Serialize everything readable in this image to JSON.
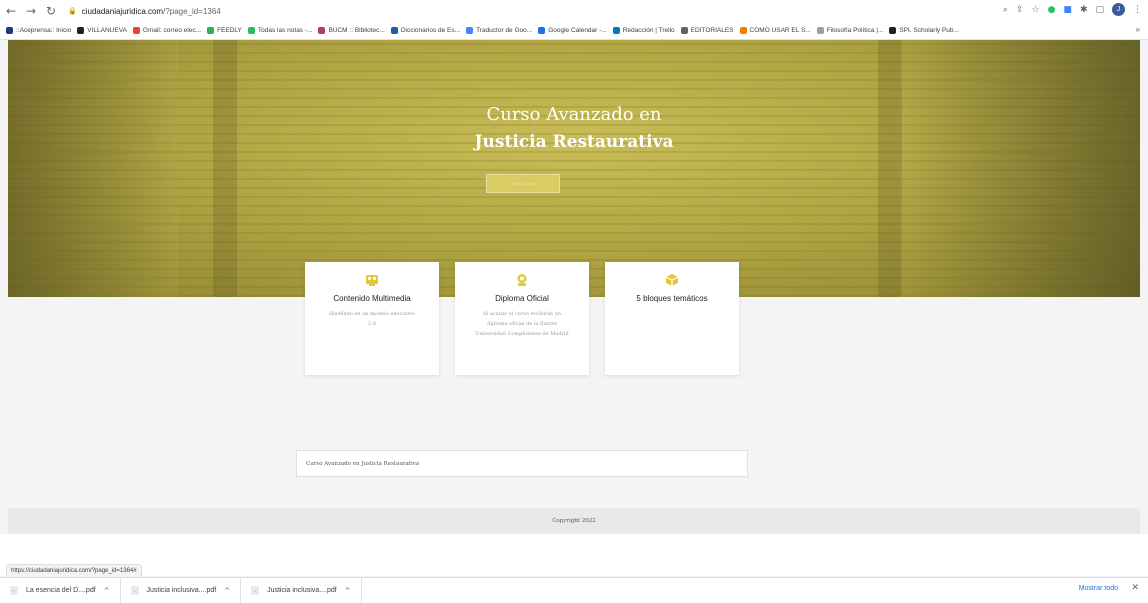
{
  "browser": {
    "url_host": "ciudadaniajuridica.com",
    "url_path": "/?page_id=1364",
    "bookmarks": [
      {
        "label": "::Aceprensa:: Inicio",
        "color": "#1a3c7a"
      },
      {
        "label": "VILLANUEVA",
        "color": "#202124"
      },
      {
        "label": "Gmail: correo elec...",
        "color": "#ea4335"
      },
      {
        "label": "FEEDLY",
        "color": "#2bb24c"
      },
      {
        "label": "Todas las notas -...",
        "color": "#2dbe60"
      },
      {
        "label": "BUCM :: Bibliotec...",
        "color": "#b3386b"
      },
      {
        "label": "Diccionarios de Es...",
        "color": "#1b5fa8"
      },
      {
        "label": "Traductor de Goo...",
        "color": "#4285f4"
      },
      {
        "label": "Google Calendar -...",
        "color": "#1a73e8"
      },
      {
        "label": "Redacción | Trello",
        "color": "#0079bf"
      },
      {
        "label": "EDITORIALES",
        "color": "#5f6368"
      },
      {
        "label": "COMO USAR EL S...",
        "color": "#f57c00"
      },
      {
        "label": "Filosofía Política |...",
        "color": "#9aa0a6"
      },
      {
        "label": "SPI. Scholarly Pub...",
        "color": "#202124"
      }
    ],
    "more": "»",
    "avatar_letter": "J",
    "status_url": "https://ciudadaniajuridica.com/?page_id=1364#"
  },
  "hero": {
    "title_line1": "Curso Avanzado en",
    "title_line2": "Justicia Restaurativa",
    "button_label": "Ver el Curso"
  },
  "cards": [
    {
      "title": "Contenido Multimedia",
      "desc": "Diseñado en un modelo educativo 2.0",
      "icon": "multimedia-icon"
    },
    {
      "title": "Diploma Oficial",
      "desc": "Al acabar el curso recibirás un diploma oficial de la Ilustre Universidad Complutense de Madrid",
      "icon": "award-icon"
    },
    {
      "title": "5 bloques temáticos",
      "desc": "",
      "icon": "box-icon"
    }
  ],
  "info_box": "Curso Avanzado en Justicia Restaurativa",
  "footer": "Copyright 2022",
  "downloads": [
    {
      "name": "La esencia del D....pdf"
    },
    {
      "name": "Justicia inclusiva....pdf"
    },
    {
      "name": "Justicia inclusiva....pdf"
    }
  ],
  "show_all": "Mostrar todo",
  "accent": "#d9c640"
}
